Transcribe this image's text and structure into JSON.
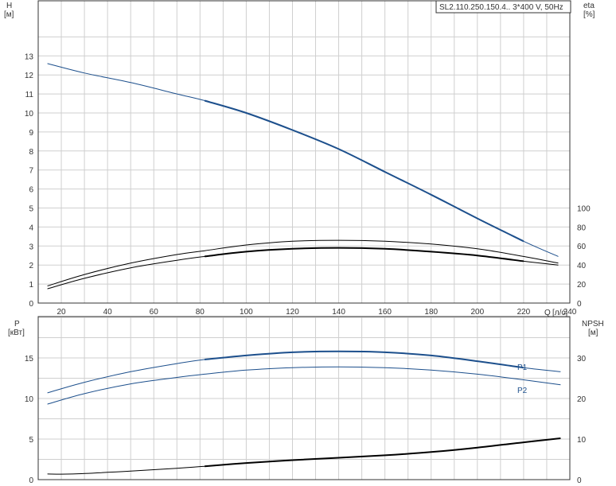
{
  "colors": {
    "blue": "#1c4f8c",
    "black": "#000000",
    "grid": "#cfcfcf",
    "frame": "#333333"
  },
  "chart_data": [
    {
      "type": "line",
      "panel": "top",
      "title": "SL2.110.250.150.4.. 3*400 V, 50Hz",
      "x_axis": {
        "label": "Q",
        "unit": "[л/с]",
        "range": [
          10,
          240
        ],
        "ticks": [
          20,
          40,
          60,
          80,
          100,
          120,
          140,
          160,
          180,
          200,
          220,
          240
        ]
      },
      "y_left": {
        "label": "H",
        "unit": "[м]",
        "range": [
          0,
          13
        ],
        "ticks": [
          0,
          1,
          2,
          3,
          4,
          5,
          6,
          7,
          8,
          9,
          10,
          11,
          12,
          13
        ]
      },
      "y_right": {
        "label": "eta",
        "unit": "[%]",
        "range": [
          0,
          100
        ],
        "ticks": [
          0,
          20,
          40,
          60,
          80,
          100
        ]
      },
      "grid": true,
      "series": [
        {
          "name": "",
          "axis": "left",
          "color": "#1c4f8c",
          "x": [
            14,
            30,
            50,
            70,
            82,
            100,
            120,
            140,
            160,
            180,
            200,
            220,
            235
          ],
          "y": [
            12.6,
            12.1,
            11.6,
            11.0,
            10.65,
            10.0,
            9.1,
            8.1,
            6.9,
            5.7,
            4.45,
            3.25,
            2.45
          ]
        },
        {
          "name": "",
          "axis": "right",
          "color": "#000000",
          "x": [
            14,
            30,
            50,
            70,
            82,
            100,
            120,
            140,
            160,
            180,
            200,
            220,
            235
          ],
          "y": [
            18,
            30,
            42,
            51,
            55,
            61,
            65,
            66,
            65,
            62,
            57,
            49,
            42
          ]
        },
        {
          "name": "",
          "axis": "right",
          "color": "#000000",
          "x": [
            14,
            30,
            50,
            70,
            82,
            100,
            120,
            140,
            160,
            180,
            200,
            220,
            235
          ],
          "y": [
            15,
            26,
            37,
            45,
            49,
            54,
            57,
            58,
            57,
            54,
            50,
            44,
            40
          ]
        }
      ]
    },
    {
      "type": "line",
      "panel": "bottom",
      "x_axis": {
        "range": [
          10,
          240
        ]
      },
      "y_left": {
        "label": "P",
        "unit": "[кВт]",
        "range": [
          0,
          20
        ],
        "ticks": [
          0,
          5,
          10,
          15
        ]
      },
      "y_right": {
        "label": "NPSH",
        "unit": "[м]",
        "range": [
          0,
          40
        ],
        "ticks": [
          0,
          10,
          20,
          30
        ]
      },
      "grid": true,
      "series": [
        {
          "name": "P1",
          "axis": "left",
          "color": "#1c4f8c",
          "x": [
            14,
            30,
            50,
            70,
            82,
            100,
            120,
            140,
            160,
            180,
            200,
            220,
            236
          ],
          "y": [
            10.7,
            12.0,
            13.3,
            14.3,
            14.8,
            15.3,
            15.7,
            15.8,
            15.7,
            15.3,
            14.6,
            13.8,
            13.3
          ]
        },
        {
          "name": "P2",
          "axis": "left",
          "color": "#1c4f8c",
          "x": [
            14,
            30,
            50,
            70,
            82,
            100,
            120,
            140,
            160,
            180,
            200,
            220,
            236
          ],
          "y": [
            9.3,
            10.6,
            11.8,
            12.6,
            13.0,
            13.5,
            13.8,
            13.9,
            13.8,
            13.5,
            13.0,
            12.3,
            11.7
          ]
        },
        {
          "name": "",
          "axis": "right",
          "color": "#000000",
          "x": [
            14,
            25,
            50,
            70,
            82,
            100,
            120,
            140,
            160,
            180,
            200,
            220,
            236
          ],
          "y": [
            1.4,
            1.4,
            2.1,
            2.8,
            3.3,
            4.1,
            4.8,
            5.4,
            6.0,
            6.8,
            7.9,
            9.2,
            10.2
          ]
        }
      ]
    }
  ]
}
